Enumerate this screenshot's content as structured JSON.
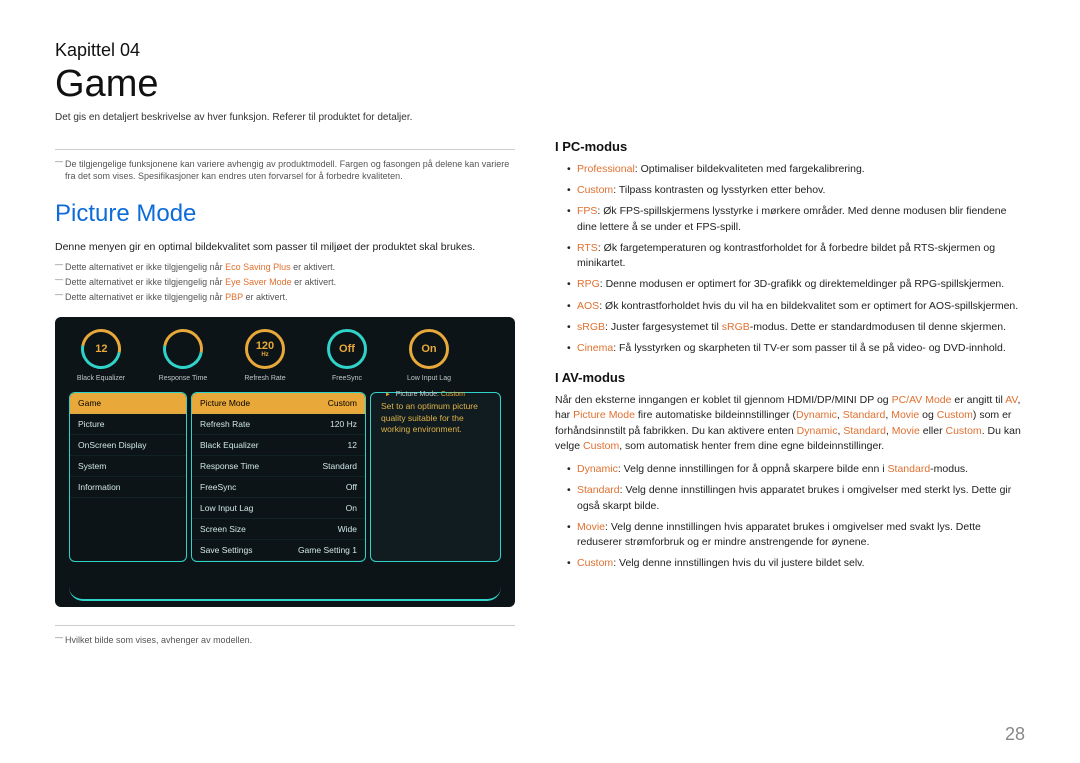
{
  "chapter_label": "Kapittel 04",
  "title": "Game",
  "subtitle": "Det gis en detaljert beskrivelse av hver funksjon. Referer til produktet for detaljer.",
  "left": {
    "top_footnote": "De tilgjengelige funksjonene kan variere avhengig av produktmodell. Fargen og fasongen på delene kan variere fra det som vises. Spesifikasjoner kan endres uten forvarsel for å forbedre kvaliteten.",
    "section_heading": "Picture Mode",
    "intro": "Denne menyen gir en optimal bildekvalitet som passer til miljøet der produktet skal brukes.",
    "fn1_pre": "Dette alternativet er ikke tilgjengelig når ",
    "fn1_key": "Eco Saving Plus",
    "fn1_post": " er aktivert.",
    "fn2_pre": "Dette alternativet er ikke tilgjengelig når ",
    "fn2_key": "Eye Saver Mode",
    "fn2_post": " er aktivert.",
    "fn3_pre": "Dette alternativet er ikke tilgjengelig når ",
    "fn3_key": "PBP",
    "fn3_post": " er aktivert.",
    "bottom_footnote": "Hvilket bilde som vises, avhenger av modellen."
  },
  "osd": {
    "gauges": [
      {
        "value": "12",
        "sub": "",
        "label": "Black Equalizer",
        "style": "partial"
      },
      {
        "value": "",
        "sub": "",
        "label": "Response Time",
        "style": "partial"
      },
      {
        "value": "120",
        "sub": "Hz",
        "label": "Refresh Rate",
        "style": "full-orange"
      },
      {
        "value": "Off",
        "sub": "",
        "label": "FreeSync",
        "style": "teal"
      },
      {
        "value": "On",
        "sub": "",
        "label": "Low Input Lag",
        "style": "full-orange"
      }
    ],
    "pm_label_pre": "Picture Mode: ",
    "pm_label_val": "Custom",
    "nav": [
      "Game",
      "Picture",
      "OnScreen Display",
      "System",
      "Information"
    ],
    "settings": [
      {
        "k": "Picture Mode",
        "v": "Custom",
        "sel": true
      },
      {
        "k": "Refresh Rate",
        "v": "120 Hz"
      },
      {
        "k": "Black Equalizer",
        "v": "12"
      },
      {
        "k": "Response Time",
        "v": "Standard"
      },
      {
        "k": "FreeSync",
        "v": "Off"
      },
      {
        "k": "Low Input Lag",
        "v": "On"
      },
      {
        "k": "Screen Size",
        "v": "Wide"
      },
      {
        "k": "Save Settings",
        "v": "Game Setting 1"
      }
    ],
    "desc": "Set to an optimum picture quality suitable for the working environment."
  },
  "right": {
    "pc_heading": "I PC-modus",
    "pc_items": [
      {
        "key": "Professional",
        "body": ": Optimaliser bildekvaliteten med fargekalibrering."
      },
      {
        "key": "Custom",
        "body": ": Tilpass kontrasten og lysstyrken etter behov."
      },
      {
        "key": "FPS",
        "body": ": Øk FPS-spillskjermens lysstyrke i mørkere områder. Med denne modusen blir fiendene dine lettere å se under et FPS-spill."
      },
      {
        "key": "RTS",
        "body": ": Øk fargetemperaturen og kontrastforholdet for å forbedre bildet på RTS-skjermen og minikartet."
      },
      {
        "key": "RPG",
        "body": ": Denne modusen er optimert for 3D-grafikk og direktemeldinger på RPG-spillskjermen."
      },
      {
        "key": "AOS",
        "body": ": Øk kontrastforholdet hvis du vil ha en bildekvalitet som er optimert for AOS-spillskjermen."
      },
      {
        "key": "sRGB",
        "body_pre": ": Juster fargesystemet til ",
        "body_key": "sRGB",
        "body_post": "-modus. Dette er standardmodusen til denne skjermen."
      },
      {
        "key": "Cinema",
        "body": ": Få lysstyrken og skarpheten til TV-er som passer til å se på video- og DVD-innhold."
      }
    ],
    "av_heading": "I AV-modus",
    "av_para": {
      "p1": "Når den eksterne inngangen er koblet til gjennom HDMI/DP/MINI DP og ",
      "k1": "PC/AV Mode",
      "p2": " er angitt til ",
      "k2": "AV",
      "p3": ", har ",
      "k3": "Picture Mode",
      "p4": " fire automatiske bildeinnstillinger (",
      "k4": "Dynamic",
      "c1": ", ",
      "k5": "Standard",
      "c2": ", ",
      "k6": "Movie",
      "p5": " og ",
      "k7": "Custom",
      "p6": ") som er forhåndsinnstilt på fabrikken. Du kan aktivere enten ",
      "k8": "Dynamic",
      "c3": ", ",
      "k9": "Standard",
      "c4": ", ",
      "k10": "Movie",
      "p7": " eller ",
      "k11": "Custom",
      "p8": ". Du kan velge ",
      "k12": "Custom",
      "p9": ", som automatisk henter frem dine egne bildeinnstillinger."
    },
    "av_items": [
      {
        "key": "Dynamic",
        "body_pre": ": Velg denne innstillingen for å oppnå skarpere bilde enn i ",
        "body_key": "Standard",
        "body_post": "-modus."
      },
      {
        "key": "Standard",
        "body": ": Velg denne innstillingen hvis apparatet brukes i omgivelser med sterkt lys. Dette gir også skarpt bilde."
      },
      {
        "key": "Movie",
        "body": ": Velg denne innstillingen hvis apparatet brukes i omgivelser med svakt lys. Dette reduserer strømforbruk og er mindre anstrengende for øynene."
      },
      {
        "key": "Custom",
        "body": ": Velg denne innstillingen hvis du vil justere bildet selv."
      }
    ]
  },
  "page_number": "28"
}
